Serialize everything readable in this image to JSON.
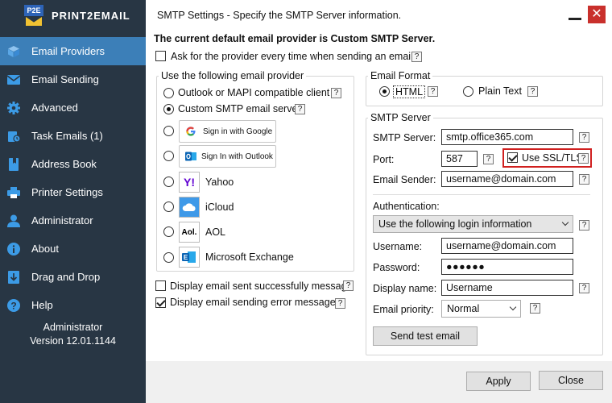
{
  "app": {
    "brand": "PRINT2EMAIL",
    "logo_text": "P2E"
  },
  "sidebar": {
    "items": [
      {
        "label": "Email Providers",
        "icon": "cube-icon"
      },
      {
        "label": "Email Sending",
        "icon": "envelope-icon"
      },
      {
        "label": "Advanced",
        "icon": "gear-icon"
      },
      {
        "label": "Task Emails (1)",
        "icon": "task-icon"
      },
      {
        "label": "Address Book",
        "icon": "book-icon"
      },
      {
        "label": "Printer Settings",
        "icon": "printer-icon"
      },
      {
        "label": "Administrator",
        "icon": "user-icon"
      },
      {
        "label": "About",
        "icon": "info-icon"
      },
      {
        "label": "Drag and Drop",
        "icon": "download-icon"
      },
      {
        "label": "Help",
        "icon": "help-icon"
      }
    ],
    "footer_user": "Administrator",
    "footer_version": "Version 12.01.1144"
  },
  "window": {
    "title": "SMTP Settings - Specify the SMTP Server information.",
    "close_glyph": "✕"
  },
  "content": {
    "heading": "The current default email provider is Custom SMTP Server.",
    "ask_provider": "Ask for the provider every time when sending an email",
    "help_glyph": "?",
    "provider_group": {
      "title": "Use the following email provider",
      "outlook_mapi": "Outlook or MAPI compatible client",
      "custom_smtp": "Custom SMTP email server",
      "google_signin": "Sign in with Google",
      "outlook_signin": "Sign In with Outlook",
      "yahoo": "Yahoo",
      "icloud": "iCloud",
      "aol": "AOL",
      "aol_logo": "Aol.",
      "exchange": "Microsoft Exchange"
    },
    "display_success": "Display email sent successfully message",
    "display_error": "Display email sending error messages",
    "format_group": {
      "title": "Email Format",
      "html": "HTML",
      "plain": "Plain Text"
    },
    "smtp_group": {
      "title": "SMTP Server",
      "server_label": "SMTP Server:",
      "server_value": "smtp.office365.com",
      "port_label": "Port:",
      "port_value": "587",
      "ssl_label": "Use SSL/TLS",
      "sender_label": "Email Sender:",
      "sender_value": "username@domain.com",
      "auth_label": "Authentication:",
      "auth_value": "Use the following login information",
      "username_label": "Username:",
      "username_value": "username@domain.com",
      "password_label": "Password:",
      "password_value": "●●●●●●",
      "display_name_label": "Display name:",
      "display_name_value": "Username",
      "priority_label": "Email priority:",
      "priority_value": "Normal",
      "test_button": "Send test email"
    },
    "apply": "Apply",
    "close": "Close"
  },
  "colors": {
    "sidebar_bg": "#283644",
    "active": "#3c7fb8",
    "highlight": "#d0201f",
    "close_bg": "#c9302c"
  }
}
